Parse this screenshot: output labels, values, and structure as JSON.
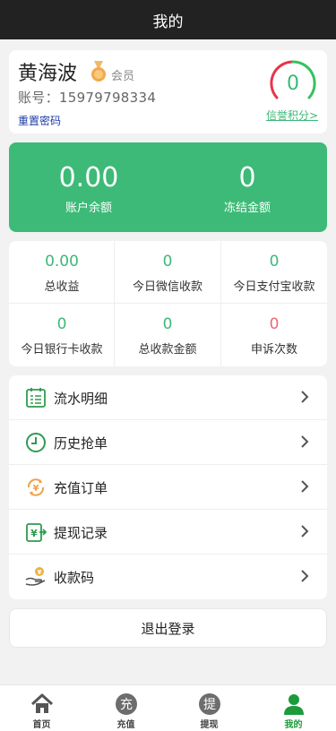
{
  "header": {
    "title": "我的"
  },
  "profile": {
    "name": "黄海波",
    "level": "会员",
    "account": "账号：15979798334",
    "reset_password": "重置密码",
    "credit_score": "0",
    "credit_link": "信誉积分>"
  },
  "balance": {
    "account_balance": "0.00",
    "account_balance_label": "账户余额",
    "frozen": "0",
    "frozen_label": "冻结金额"
  },
  "stats": [
    {
      "value": "0.00",
      "label": "总收益"
    },
    {
      "value": "0",
      "label": "今日微信收款"
    },
    {
      "value": "0",
      "label": "今日支付宝收款"
    },
    {
      "value": "0",
      "label": "今日银行卡收款"
    },
    {
      "value": "0",
      "label": "总收款金额"
    },
    {
      "value": "0",
      "label": "申诉次数"
    }
  ],
  "menu": [
    {
      "label": "流水明细",
      "icon": "ledger-icon"
    },
    {
      "label": "历史抢单",
      "icon": "clock-icon"
    },
    {
      "label": "充值订单",
      "icon": "recharge-icon"
    },
    {
      "label": "提现记录",
      "icon": "withdraw-icon"
    },
    {
      "label": "收款码",
      "icon": "payment-code-icon"
    }
  ],
  "logout": "退出登录",
  "tabs": [
    {
      "label": "首页",
      "icon": "home-icon"
    },
    {
      "label": "充值",
      "icon_text": "充"
    },
    {
      "label": "提现",
      "icon_text": "提"
    },
    {
      "label": "我的",
      "icon": "user-icon"
    }
  ],
  "colors": {
    "accent": "#3dba77",
    "header": "#222222",
    "active_tab": "#1c9b3a",
    "appeal": "#e86a77"
  }
}
